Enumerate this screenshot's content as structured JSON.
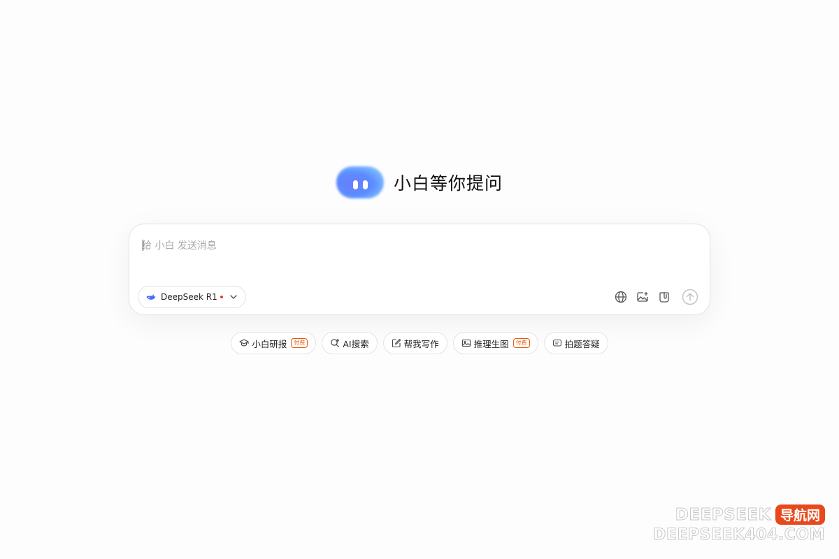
{
  "hero": {
    "title": "小白等你提问"
  },
  "composer": {
    "placeholder": "给 小白 发送消息",
    "value": "",
    "model": {
      "label": "DeepSeek R1",
      "icon": "whale-icon",
      "status_color": "#e53935"
    },
    "tools": [
      "globe-icon",
      "image-upload-icon",
      "attachment-icon",
      "send-icon"
    ]
  },
  "chips": [
    {
      "label": "小白研报",
      "icon": "graduation-cap-icon",
      "badge": "付费"
    },
    {
      "label": "AI搜索",
      "icon": "search-spark-icon",
      "badge": ""
    },
    {
      "label": "帮我写作",
      "icon": "edit-icon",
      "badge": ""
    },
    {
      "label": "推理生图",
      "icon": "image-icon",
      "badge": "付费"
    },
    {
      "label": "拍题答疑",
      "icon": "message-icon",
      "badge": ""
    }
  ],
  "watermark": {
    "line1": "DEEPSEEK",
    "tag": "导航网",
    "line2": "DEEPSEEK404.COM"
  },
  "colors": {
    "accent": "#5a8cff",
    "badge": "#e8590c",
    "border": "#e3e3e6"
  }
}
